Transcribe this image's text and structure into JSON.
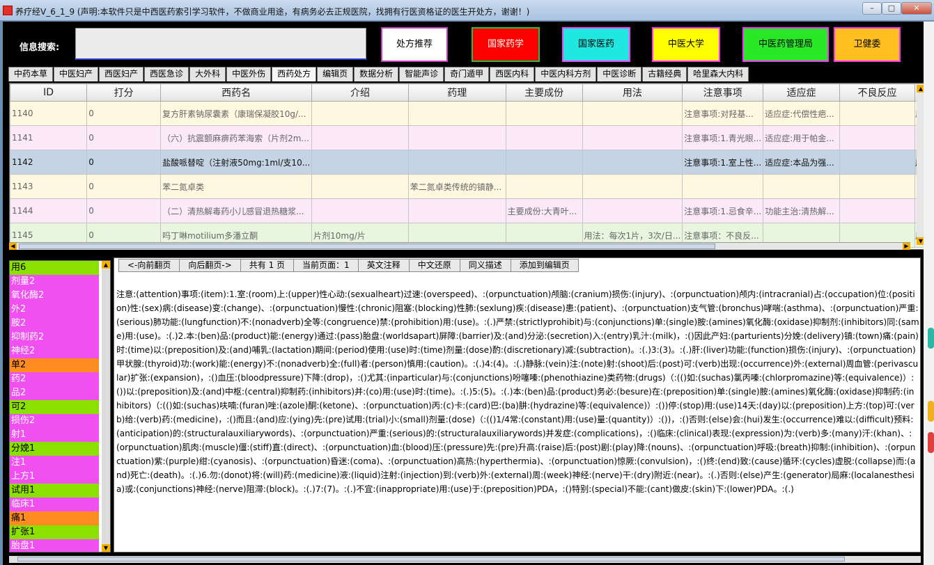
{
  "window": {
    "title": "养疗经V_6_1_9  (声明:本软件只是中西医药索引学习软件，不做商业用途，有病务必去正规医院，找拥有行医资格证的医生开处方，谢谢！)",
    "minimize": "–",
    "maximize": "□",
    "close": "✕"
  },
  "search": {
    "label": "信息搜索:",
    "value": ""
  },
  "top_buttons": [
    {
      "label": "处方推荐",
      "bg": "#ffffff",
      "fg": "#000000",
      "border": "#c040c0"
    },
    {
      "label": "国家药学",
      "bg": "#ff0000",
      "fg": "#ffffff",
      "border": "#20c040"
    },
    {
      "label": "国家医药",
      "bg": "#20e8e0",
      "fg": "#000000",
      "border": "#ff3cff"
    },
    {
      "label": "中医大学",
      "bg": "#ffff00",
      "fg": "#000000",
      "border": "#ff30ff"
    },
    {
      "label": "中医药管理局",
      "bg": "#28e828",
      "fg": "#000000",
      "border": "#ff30ff"
    },
    {
      "label": "卫健委",
      "bg": "#ffc020",
      "fg": "#000000",
      "border": "#ff30ff"
    }
  ],
  "tabs": [
    "中药本草",
    "中医妇产",
    "西医妇产",
    "西医急诊",
    "大外科",
    "中医外伤",
    "西药处方",
    "编辑页",
    "数据分析",
    "智能声诊",
    "奇门遁甲",
    "西医内科",
    "中医内科方剂",
    "中医诊断",
    "古籍经典",
    "哈里森大内科"
  ],
  "active_tab": "西药处方",
  "grid": {
    "columns": [
      "ID",
      "打分",
      "西药名",
      "介绍",
      "药理",
      "主要成份",
      "用法",
      "注意事项",
      "适应症",
      "不良反应"
    ],
    "rows": [
      {
        "bg": "#fff8e1",
        "cells": [
          "1140",
          "0",
          "复方肝素钠尿囊素（康瑞保凝胶10g/...",
          "",
          "",
          "",
          "",
          "注意事项:对羟基...",
          "适应症:代偿性疤...",
          ""
        ],
        "extra": "用"
      },
      {
        "bg": "#fbe9f8",
        "cells": [
          "1141",
          "0",
          "（六）抗震颤麻痹药苯海索（片剂2m...",
          "",
          "",
          "",
          "",
          "注意事项:1.青光眼...",
          "适应症:用于帕金...",
          ""
        ],
        "extra": ""
      },
      {
        "bg": "#c5d4e4",
        "cells": [
          "1142",
          "0",
          "盐酸哌替啶（注射液50mg:1ml/支10...",
          "",
          "",
          "",
          "",
          "注意事项:1.室上性...",
          "适应症:本品为强...",
          ""
        ],
        "extra": "用"
      },
      {
        "bg": "#fff8e1",
        "cells": [
          "1143",
          "0",
          "苯二氮卓类",
          "",
          "苯二氮卓类传统的镇静...",
          "",
          "",
          "",
          "",
          ""
        ],
        "extra": ""
      },
      {
        "bg": "#fbe9f8",
        "cells": [
          "1144",
          "0",
          "（二）清热解毒药小儿感冒退热糖浆...",
          "",
          "",
          "主要成份:大青叶...",
          "",
          "注意事项:1.忌食辛...",
          "功能主治:清热解...",
          ""
        ],
        "extra": ""
      },
      {
        "bg": "#e8f6e0",
        "cells": [
          "1145",
          "0",
          "吗丁啉motilium多潘立酮",
          "片剂10mg/片",
          "",
          "",
          "用法：每次1片，3次/日...",
          "注意事项：不良反...",
          "",
          ""
        ],
        "extra": "用"
      }
    ]
  },
  "left_list": [
    {
      "text": "用6",
      "color": "g"
    },
    {
      "text": "剂量2",
      "color": "m"
    },
    {
      "text": "氧化酶2",
      "color": "m"
    },
    {
      "text": "外2",
      "color": "m"
    },
    {
      "text": "胺2",
      "color": "m"
    },
    {
      "text": "抑制药2",
      "color": "m"
    },
    {
      "text": "神经2",
      "color": "m"
    },
    {
      "text": "单2",
      "color": "o"
    },
    {
      "text": "药2",
      "color": "m"
    },
    {
      "text": "品2",
      "color": "m"
    },
    {
      "text": "可2",
      "color": "g"
    },
    {
      "text": "损伤2",
      "color": "m"
    },
    {
      "text": "射1",
      "color": "m"
    },
    {
      "text": "分娩1",
      "color": "g"
    },
    {
      "text": "注1",
      "color": "m"
    },
    {
      "text": "上方1",
      "color": "m"
    },
    {
      "text": "试用1",
      "color": "g"
    },
    {
      "text": "临床1",
      "color": "m"
    },
    {
      "text": "痛1",
      "color": "o"
    },
    {
      "text": "扩张1",
      "color": "g"
    },
    {
      "text": "胎盘1",
      "color": "m"
    }
  ],
  "pager": [
    "<-向前翻页",
    "向后翻页->",
    "共有 1 页",
    "当前页面：1",
    "英文注释",
    "中文还原",
    "同义描述",
    "添加到编辑页"
  ],
  "body_text": "注意:(attention)事项:(item):1.室:(room)上:(upper)性心动:(sexualheart)过速:(overspeed)、:(orpunctuation)颅脑:(cranium)损伤:(injury)、:(orpunctuation)颅内:(intracranial)占:(occupation)位:(position)性:(sex)病:(disease)变:(change)、:(orpunctuation)慢性:(chronic)阻塞:(blocking)性肺:(sexlung)疾:(disease)患:(patient)、:(orpunctuation)支气管:(bronchus)哮喘:(asthma)、:(orpunctuation)严重:(serious)肺功能:(lungfunction)不:(nonadverb)全等:(congruence)禁:(prohibition)用:(use)。:(.)严禁:(strictlyprohibit)与:(conjunctions)单:(single)胺:(amines)氧化酶:(oxidase)抑制剂:(inhibitors)同:(same)用:(use)。:(.)2.本:(ben)品:(product)能:(energy)通过:(pass)胎盘:(worldsapart)屏障:(barrier)及:(and)分泌:(secretion)入:(entry)乳汁:(milk)，:()因此产妇:(parturients)分娩:(delivery)镇:(town)痛:(pain)时:(time)以:(preposition)及:(and)哺乳:(lactation)期间:(period)使用:(use)时:(time)剂量:(dose)酌:(discretionary)减:(subtraction)。:(.)3:(3)。:(.)肝:(liver)功能:(function)损伤:(injury)、:(orpunctuation)甲状腺:(thyroid)功:(work)能:(energy)不:(nonadverb)全:(full)者:(person)慎用:(caution)。:(.)4:(4)。:(.)静脉:(vein)注:(note)射:(shoot)后:(post)可:(verb)出现:(occurrence)外:(external)周血管:(perivascular)扩张:(expansion)，:()血压:(bloodpressure)下降:(drop)，:()尤其:(inparticular)与:(conjunctions)吩噻嗪:(phenothiazine)类药物:(drugs)（:(()如:(suchas)氯丙嗪:(chlorpromazine)等:(equivalence)）:())以:(preposition)及:(and)中枢:(central)抑制药:(inhibitors)并:(co)用:(use)时:(time)。:(.)5:(5)。:(.)本:(ben)品:(product)务必:(besure)在:(preposition)单:(single)胺:(amines)氧化酶:(oxidase)抑制药:(inhibitors)（:(()如:(suchas)呋喃:(furan)唑:(azole)酮:(ketone)、:(orpunctuation)丙:(c)卡:(card)巴:(ba)肼:(hydrazine)等:(equivalence)）:())停:(stop)用:(use)14天:(day)以:(preposition)上方:(top)可:(verb)给:(verb)药:(medicine)，:()而且:(and)应:(ying)先:(pre)试用:(trial)小:(small)剂量:(dose)（:(()1/4常:(constant)用:(use)量:(quantity)）:())，:()否则:(else)会:(hui)发生:(occurrence)难以:(difficult)预料:(anticipation)的:(structuralauxiliarywords)、:(orpunctuation)严重:(serious)的:(structuralauxiliarywords)并发症:(complications)，:()临床:(clinical)表现:(expression)为:(verb)多:(many)汗:(khan)、:(orpunctuation)肌肉:(muscle)僵:(stiff)直:(direct)、:(orpunctuation)血:(blood)压:(pressure)先:(pre)升高:(raise)后:(post)剧:(play)降:(nouns)、:(orpunctuation)呼吸:(breath)抑制:(inhibition)、:(orpunctuation)紫:(purple)绀:(cyanosis)、:(orpunctuation)昏迷:(coma)、:(orpunctuation)高热:(hyperthermia)、:(orpunctuation)惊厥:(convulsion)，:()终:(end)致:(cause)循环:(cycles)虚脱:(collapse)而:(and)死亡:(death)。:(.)6.勿:(donot)将:(will)药:(medicine)液:(liquid)注射:(injection)到:(verb)外:(external)周:(week)神经:(nerve)干:(dry)附近:(near)。:(.)否则:(else)产生:(generator)局麻:(localanesthesia)或:(conjunctions)神经:(nerve)阻滞:(block)。:(.)7:(7)。:(.)不宜:(inappropriate)用:(use)于:(preposition)PDA，:()特别:(special)不能:(cant)做皮:(skin)下:(lower)PDA。:(.)"
}
